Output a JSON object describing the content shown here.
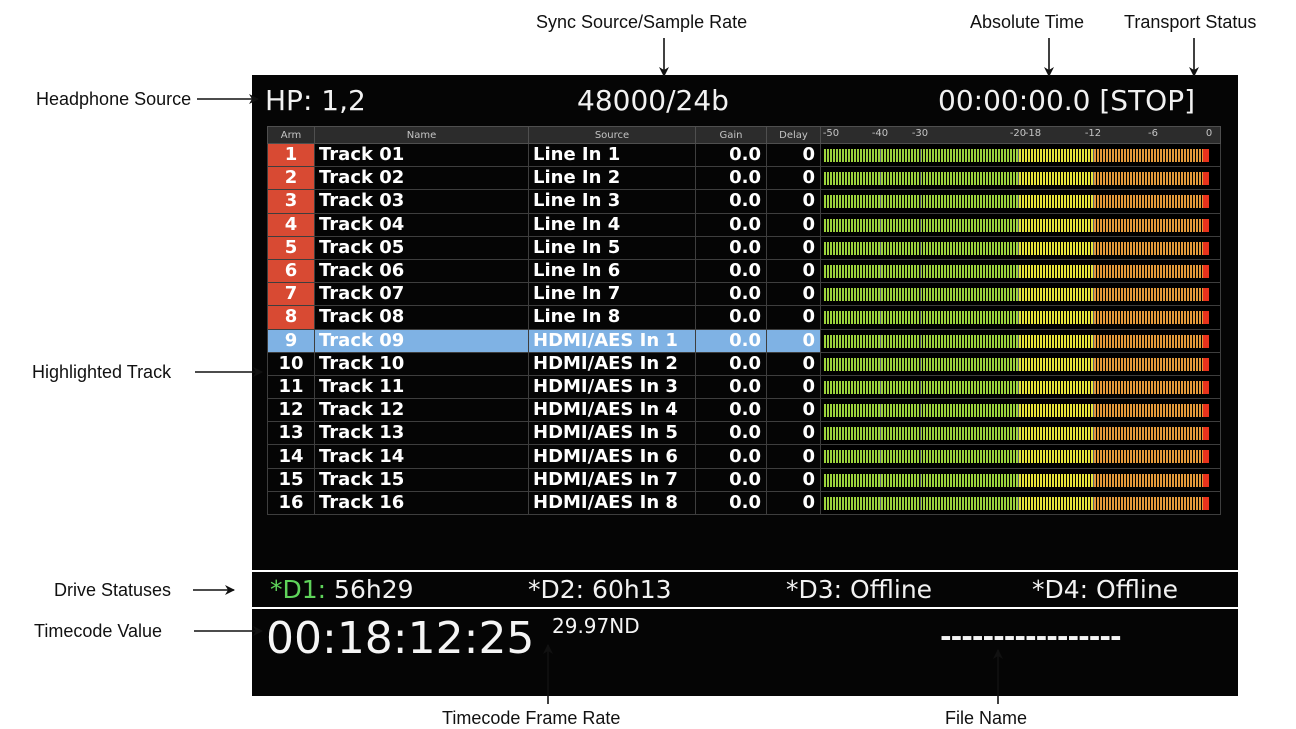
{
  "callouts": {
    "sync_source": "Sync Source/Sample Rate",
    "absolute_time": "Absolute Time",
    "transport_status": "Transport Status",
    "headphone_source": "Headphone Source",
    "highlighted_track": "Highlighted Track",
    "drive_statuses": "Drive Statuses",
    "timecode_value": "Timecode Value",
    "timecode_frame_rate": "Timecode Frame Rate",
    "file_name": "File Name"
  },
  "header": {
    "hp": "HP: 1,2",
    "sample_rate": "48000/24b",
    "abs_time": "00:00:00.0 [STOP]"
  },
  "columns": {
    "arm": "Arm",
    "name": "Name",
    "source": "Source",
    "gain": "Gain",
    "delay": "Delay"
  },
  "meter_scale": [
    "-50",
    "-40",
    "-30",
    "-20",
    "-18",
    "-12",
    "-6",
    "0"
  ],
  "tracks": [
    {
      "arm": "1",
      "name": "Track 01",
      "source": "Line In 1",
      "gain": "0.0",
      "delay": "0",
      "armed": true,
      "highlighted": false
    },
    {
      "arm": "2",
      "name": "Track 02",
      "source": "Line In 2",
      "gain": "0.0",
      "delay": "0",
      "armed": true,
      "highlighted": false
    },
    {
      "arm": "3",
      "name": "Track 03",
      "source": "Line In 3",
      "gain": "0.0",
      "delay": "0",
      "armed": true,
      "highlighted": false
    },
    {
      "arm": "4",
      "name": "Track 04",
      "source": "Line In 4",
      "gain": "0.0",
      "delay": "0",
      "armed": true,
      "highlighted": false
    },
    {
      "arm": "5",
      "name": "Track 05",
      "source": "Line In 5",
      "gain": "0.0",
      "delay": "0",
      "armed": true,
      "highlighted": false
    },
    {
      "arm": "6",
      "name": "Track 06",
      "source": "Line In 6",
      "gain": "0.0",
      "delay": "0",
      "armed": true,
      "highlighted": false
    },
    {
      "arm": "7",
      "name": "Track 07",
      "source": "Line In 7",
      "gain": "0.0",
      "delay": "0",
      "armed": true,
      "highlighted": false
    },
    {
      "arm": "8",
      "name": "Track 08",
      "source": "Line In 8",
      "gain": "0.0",
      "delay": "0",
      "armed": true,
      "highlighted": false
    },
    {
      "arm": "9",
      "name": "Track 09",
      "source": "HDMI/AES In 1",
      "gain": "0.0",
      "delay": "0",
      "armed": false,
      "highlighted": true
    },
    {
      "arm": "10",
      "name": "Track 10",
      "source": "HDMI/AES In 2",
      "gain": "0.0",
      "delay": "0",
      "armed": false,
      "highlighted": false
    },
    {
      "arm": "11",
      "name": "Track 11",
      "source": "HDMI/AES In 3",
      "gain": "0.0",
      "delay": "0",
      "armed": false,
      "highlighted": false
    },
    {
      "arm": "12",
      "name": "Track 12",
      "source": "HDMI/AES In 4",
      "gain": "0.0",
      "delay": "0",
      "armed": false,
      "highlighted": false
    },
    {
      "arm": "13",
      "name": "Track 13",
      "source": "HDMI/AES In 5",
      "gain": "0.0",
      "delay": "0",
      "armed": false,
      "highlighted": false
    },
    {
      "arm": "14",
      "name": "Track 14",
      "source": "HDMI/AES In 6",
      "gain": "0.0",
      "delay": "0",
      "armed": false,
      "highlighted": false
    },
    {
      "arm": "15",
      "name": "Track 15",
      "source": "HDMI/AES In 7",
      "gain": "0.0",
      "delay": "0",
      "armed": false,
      "highlighted": false
    },
    {
      "arm": "16",
      "name": "Track 16",
      "source": "HDMI/AES In 8",
      "gain": "0.0",
      "delay": "0",
      "armed": false,
      "highlighted": false
    }
  ],
  "drives": [
    {
      "id": "*D1:",
      "value": "56h29",
      "id_color": "#5fd35a"
    },
    {
      "id": "*D2:",
      "value": "60h13",
      "id_color": "#f2f2f2"
    },
    {
      "id": "*D3:",
      "value": "Offline",
      "id_color": "#f2f2f2"
    },
    {
      "id": "*D4:",
      "value": "Offline",
      "id_color": "#f2f2f2"
    }
  ],
  "timecode": {
    "value": "00:18:12:25",
    "frame_rate": "29.97ND"
  },
  "file_name": "-----------------",
  "colors": {
    "armed": "#d84a33",
    "highlight": "#7fb2e4",
    "meter_green": "#9bd23c",
    "meter_yellow": "#e6e43a",
    "meter_orange": "#e39a3a",
    "meter_clip": "#e8321c"
  }
}
